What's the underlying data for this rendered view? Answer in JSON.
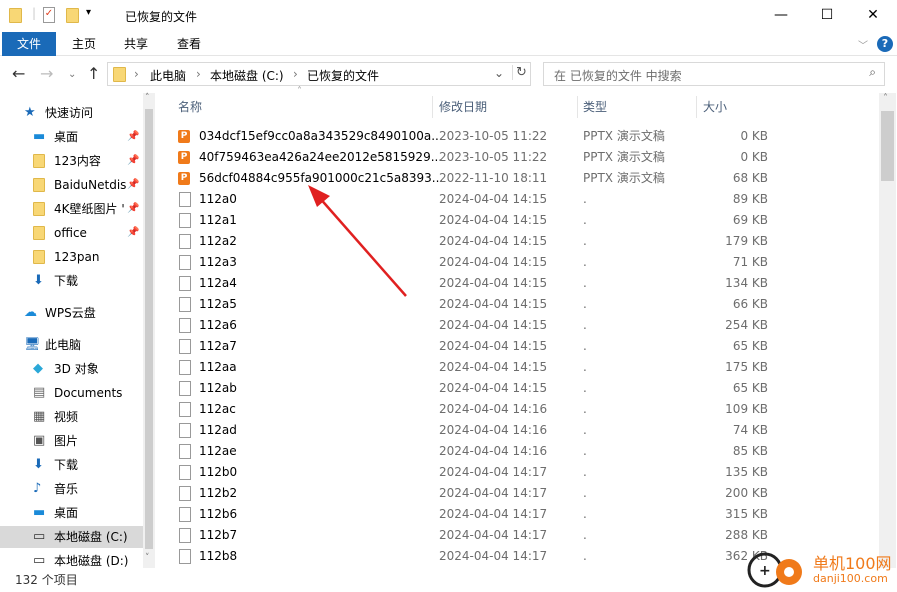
{
  "window": {
    "title": "已恢复的文件",
    "minimize": "—",
    "maximize": "☐",
    "close": "✕"
  },
  "ribbon": {
    "tabs": [
      "文件",
      "主页",
      "共享",
      "查看"
    ],
    "help": "?"
  },
  "address": {
    "crumbs": [
      "此电脑",
      "本地磁盘 (C:)",
      "已恢复的文件"
    ],
    "search_placeholder": "在 已恢复的文件 中搜索"
  },
  "sidebar": {
    "items": [
      {
        "label": "快速访问",
        "icon": "star-icon"
      },
      {
        "label": "桌面",
        "icon": "desktop-icon",
        "pinned": true
      },
      {
        "label": "123内容",
        "icon": "folder-icon",
        "pinned": true
      },
      {
        "label": "BaiduNetdis",
        "icon": "folder-icon",
        "pinned": true
      },
      {
        "label": "4K壁纸图片 '",
        "icon": "folder-icon",
        "pinned": true
      },
      {
        "label": "office",
        "icon": "folder-icon",
        "pinned": true
      },
      {
        "label": "123pan",
        "icon": "folder-icon"
      },
      {
        "label": "下载",
        "icon": "download-icon"
      },
      {
        "label": "WPS云盘",
        "icon": "cloud-icon"
      },
      {
        "label": "此电脑",
        "icon": "computer-icon"
      },
      {
        "label": "3D 对象",
        "icon": "cube-icon"
      },
      {
        "label": "Documents",
        "icon": "document-icon"
      },
      {
        "label": "视频",
        "icon": "video-icon"
      },
      {
        "label": "图片",
        "icon": "picture-icon"
      },
      {
        "label": "下载",
        "icon": "download-icon"
      },
      {
        "label": "音乐",
        "icon": "music-icon"
      },
      {
        "label": "桌面",
        "icon": "desktop-icon"
      },
      {
        "label": "本地磁盘 (C:)",
        "icon": "drive-icon",
        "selected": true
      },
      {
        "label": "本地磁盘 (D:)",
        "icon": "drive-icon"
      }
    ]
  },
  "columns": {
    "name": "名称",
    "date": "修改日期",
    "type": "类型",
    "size": "大小"
  },
  "files": [
    {
      "name": "034dcf15ef9cc0a8a343529c8490100a...",
      "date": "2023-10-05 11:22",
      "type": "PPTX 演示文稿",
      "size": "0 KB",
      "pptx": true
    },
    {
      "name": "40f759463ea426a24ee2012e5815929...",
      "date": "2023-10-05 11:22",
      "type": "PPTX 演示文稿",
      "size": "0 KB",
      "pptx": true
    },
    {
      "name": "56dcf04884c955fa901000c21c5a8393...",
      "date": "2022-11-10 18:11",
      "type": "PPTX 演示文稿",
      "size": "68 KB",
      "pptx": true
    },
    {
      "name": "112a0",
      "date": "2024-04-04 14:15",
      "type": ".",
      "size": "89 KB"
    },
    {
      "name": "112a1",
      "date": "2024-04-04 14:15",
      "type": ".",
      "size": "69 KB"
    },
    {
      "name": "112a2",
      "date": "2024-04-04 14:15",
      "type": ".",
      "size": "179 KB"
    },
    {
      "name": "112a3",
      "date": "2024-04-04 14:15",
      "type": ".",
      "size": "71 KB"
    },
    {
      "name": "112a4",
      "date": "2024-04-04 14:15",
      "type": ".",
      "size": "134 KB"
    },
    {
      "name": "112a5",
      "date": "2024-04-04 14:15",
      "type": ".",
      "size": "66 KB"
    },
    {
      "name": "112a6",
      "date": "2024-04-04 14:15",
      "type": ".",
      "size": "254 KB"
    },
    {
      "name": "112a7",
      "date": "2024-04-04 14:15",
      "type": ".",
      "size": "65 KB"
    },
    {
      "name": "112aa",
      "date": "2024-04-04 14:15",
      "type": ".",
      "size": "175 KB"
    },
    {
      "name": "112ab",
      "date": "2024-04-04 14:15",
      "type": ".",
      "size": "65 KB"
    },
    {
      "name": "112ac",
      "date": "2024-04-04 14:16",
      "type": ".",
      "size": "109 KB"
    },
    {
      "name": "112ad",
      "date": "2024-04-04 14:16",
      "type": ".",
      "size": "74 KB"
    },
    {
      "name": "112ae",
      "date": "2024-04-04 14:16",
      "type": ".",
      "size": "85 KB"
    },
    {
      "name": "112b0",
      "date": "2024-04-04 14:17",
      "type": ".",
      "size": "135 KB"
    },
    {
      "name": "112b2",
      "date": "2024-04-04 14:17",
      "type": ".",
      "size": "200 KB"
    },
    {
      "name": "112b6",
      "date": "2024-04-04 14:17",
      "type": ".",
      "size": "315 KB"
    },
    {
      "name": "112b7",
      "date": "2024-04-04 14:17",
      "type": ".",
      "size": "288 KB"
    },
    {
      "name": "112b8",
      "date": "2024-04-04 14:17",
      "type": ".",
      "size": "362 KB"
    }
  ],
  "status": {
    "count": "132 个项目"
  },
  "watermark": {
    "cn": "单机100网",
    "url": "danji100.com"
  },
  "colors": {
    "accent": "#1a6ab8",
    "annotation_arrow": "#e02020",
    "selected": "#cce8ff"
  }
}
